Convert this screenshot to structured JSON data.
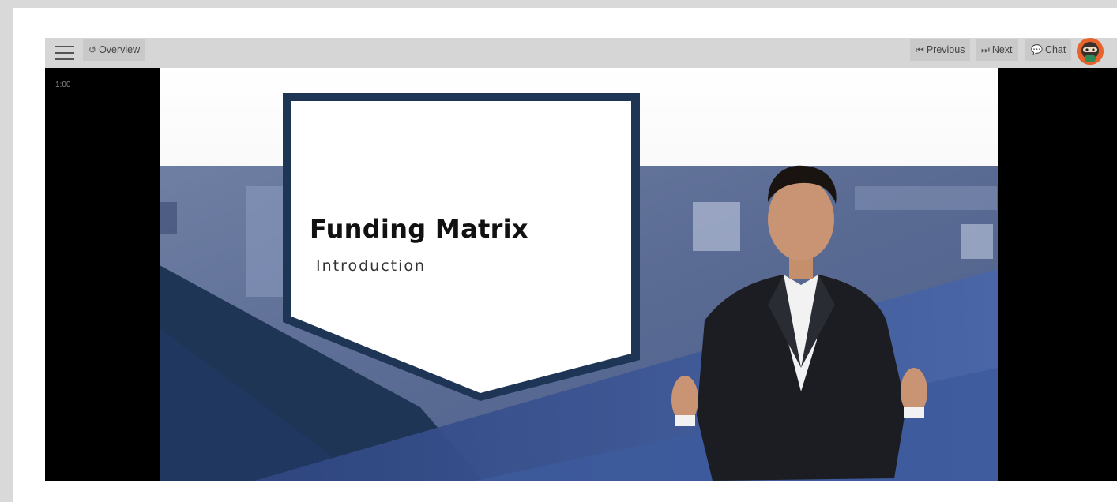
{
  "toolbar": {
    "overview_label": "Overview",
    "previous_label": "Previous",
    "next_label": "Next",
    "chat_label": "Chat",
    "menu_icon": "hamburger-menu-icon",
    "overview_icon": "undo-icon",
    "previous_icon": "skip-back-icon",
    "next_icon": "skip-forward-icon",
    "chat_icon": "chat-bubbles-icon",
    "avatar_icon": "ninja-avatar-icon"
  },
  "video": {
    "timer": "1:00"
  },
  "slide": {
    "title": "Funding Matrix",
    "subtitle": "Introduction"
  },
  "colors": {
    "background": "#d9d9d9",
    "toolbar": "#d6d6d6",
    "button": "#c9c9c9",
    "slide_navy": "#1f3556",
    "slide_blue": "#3f5a95",
    "avatar": "#e8622c"
  }
}
